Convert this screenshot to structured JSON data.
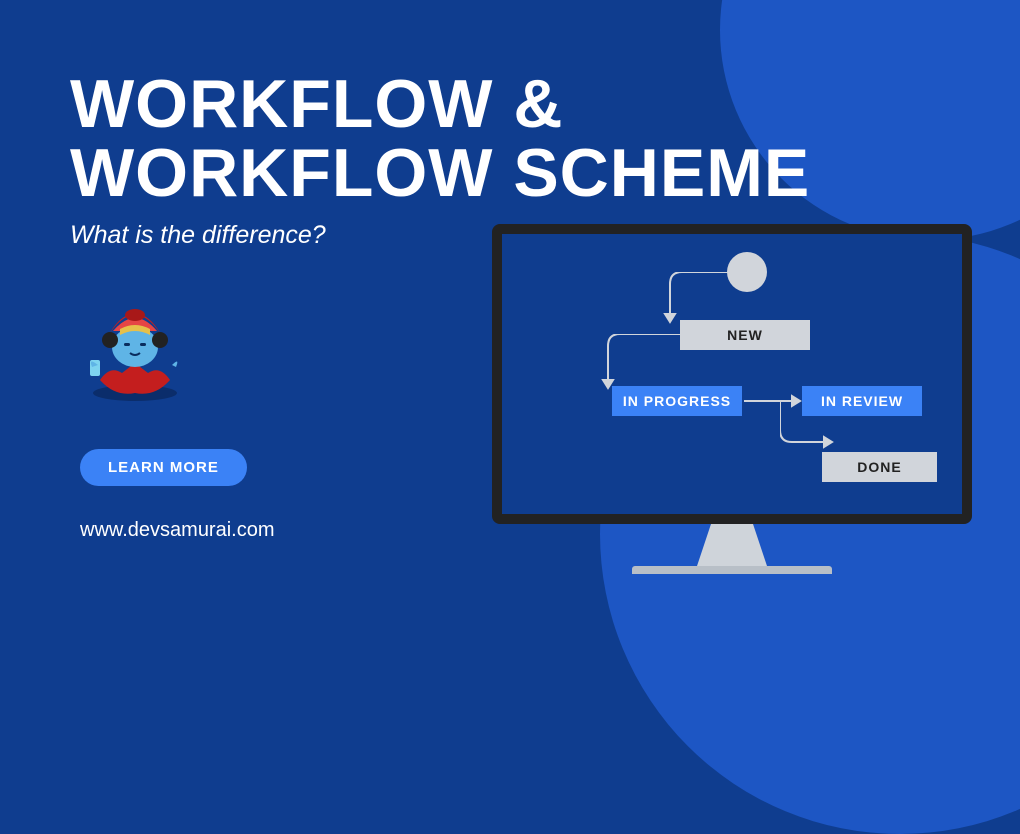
{
  "title_line1": "WORKFLOW &",
  "title_line2": "WORKFLOW SCHEME",
  "subtitle": "What is the difference?",
  "cta": "LEARN MORE",
  "url": "www.devsamurai.com",
  "workflow": {
    "status_new": "NEW",
    "status_in_progress": "IN PROGRESS",
    "status_in_review": "IN REVIEW",
    "status_done": "DONE"
  },
  "colors": {
    "bg_dark": "#0f3d8f",
    "bg_light": "#1d56c4",
    "accent": "#3b82f6",
    "gray": "#d1d5db"
  }
}
